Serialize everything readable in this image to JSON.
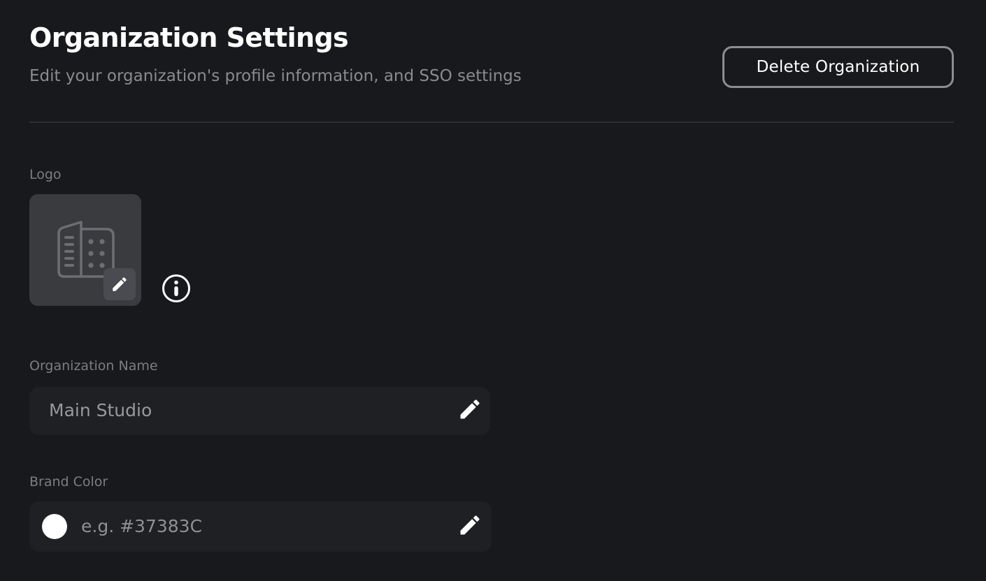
{
  "header": {
    "title": "Organization Settings",
    "subtitle": "Edit your organization's profile information, and SSO settings",
    "delete_button_label": "Delete Organization"
  },
  "logo": {
    "label": "Logo",
    "placeholder_icon": "building-icon",
    "edit_icon": "pencil-icon",
    "info_icon": "info-icon"
  },
  "organization_name": {
    "label": "Organization Name",
    "value": "Main Studio",
    "edit_icon": "pencil-icon"
  },
  "brand_color": {
    "label": "Brand Color",
    "value": "",
    "placeholder": "e.g. #37383C",
    "swatch_color": "#ffffff",
    "edit_icon": "pencil-icon"
  },
  "colors": {
    "background": "#18191c",
    "input_background": "#1f2024",
    "logo_tile": "#3a3b3f",
    "muted_text": "#7c7d82",
    "button_border": "#8d8e92"
  }
}
